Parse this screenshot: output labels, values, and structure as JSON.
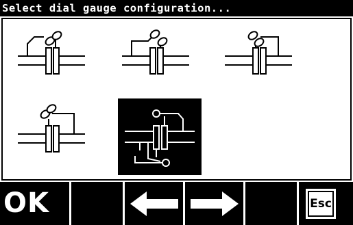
{
  "title": "Select dial gauge configuration...",
  "configurations": [
    {
      "id": "config-1",
      "selected": false
    },
    {
      "id": "config-2",
      "selected": false
    },
    {
      "id": "config-3",
      "selected": false
    },
    {
      "id": "config-4",
      "selected": false
    },
    {
      "id": "config-5",
      "selected": true
    }
  ],
  "softkeys": {
    "ok_label": "OK",
    "left_icon": "left-arrow-icon",
    "right_icon": "right-arrow-icon",
    "esc_label": "Esc"
  },
  "colors": {
    "background": "#ffffff",
    "foreground": "#000000",
    "selected_bg": "#000000"
  }
}
